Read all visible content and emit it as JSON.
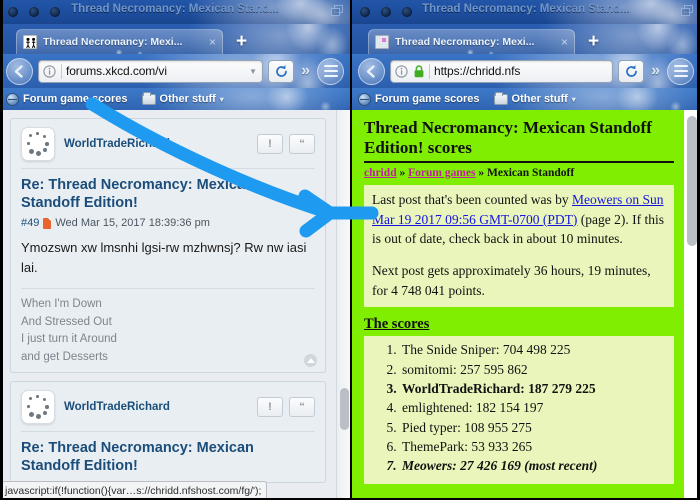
{
  "left_window": {
    "title": "Thread Necromancy: Mexican Stand...",
    "tab": {
      "label": "Thread Necromancy: Mexi...",
      "favicon": "xkcd-favicon",
      "close": "×"
    },
    "new_tab": "+",
    "nav": {
      "back_icon": "back-arrow-icon",
      "info_icon": "info-circle-icon",
      "url": "forums.xkcd.com/vi",
      "url_dim": "",
      "url_caret": "▼",
      "reload_icon": "reload-icon",
      "overflow": "»",
      "menu_icon": "hamburger-icon"
    },
    "bookmarks": [
      {
        "label": "Forum game scores",
        "icon": "globe-icon"
      },
      {
        "label": "Other stuff",
        "icon": "folder-icon",
        "caret": "▾"
      }
    ],
    "posts": [
      {
        "author": "WorldTradeRichard",
        "avatar": "dice-avatar",
        "buttons": [
          "!",
          "“"
        ],
        "subject": "Re: Thread Necromancy: Mexican Standoff Edition!",
        "post_number": "#49",
        "timestamp": "Wed Mar 15, 2017 18:39:36 pm",
        "body": "Ymozswn xw lmsnhi lgsi-rw mzhwnsj? Rw nw iasi lai.",
        "signature": [
          "When I'm Down",
          "And Stressed Out",
          "I just turn it Around",
          "and get Desserts"
        ]
      },
      {
        "author": "WorldTradeRichard",
        "avatar": "dice-avatar",
        "buttons": [
          "!",
          "“"
        ],
        "subject": "Re: Thread Necromancy: Mexican Standoff Edition!"
      }
    ],
    "status_bar": "javascript:if(!function(){var…s://chridd.nfshost.com/fg/');"
  },
  "right_window": {
    "title": "Thread Necromancy: Mexican Stand...",
    "tab": {
      "label": "Thread Necromancy: Mexi...",
      "favicon": "chridd-favicon",
      "close": "×"
    },
    "new_tab": "+",
    "nav": {
      "back_icon": "back-arrow-icon",
      "info_icon": "info-circle-icon",
      "lock_icon": "padlock-icon",
      "url": "https://chridd.nfs",
      "reload_icon": "reload-icon",
      "overflow": "»",
      "menu_icon": "hamburger-icon"
    },
    "bookmarks": [
      {
        "label": "Forum game scores",
        "icon": "globe-icon"
      },
      {
        "label": "Other stuff",
        "icon": "folder-icon",
        "caret": "▾"
      }
    ],
    "page": {
      "heading": "Thread Necromancy: Mexican Standoff Edition! scores",
      "breadcrumb": {
        "first": "chridd",
        "sep1": " » ",
        "second": "Forum games",
        "sep2": " » ",
        "third": "Mexican Standoff"
      },
      "status_p1_before": "Last post that's been counted was by ",
      "status_p1_link": "Meowers on Sun Mar 19 2017 09:56 GMT-0700 (PDT)",
      "status_p1_after": " (page 2). If this is out of date, check back in about 10 minutes.",
      "status_p2": "Next post gets approximately 36 hours, 19 minutes, for 4 748 041 points.",
      "scores_heading": "The scores",
      "scores": [
        {
          "text": "The Snide Sniper: 704 498 225",
          "style": "normal"
        },
        {
          "text": "somitomi: 257 595 862",
          "style": "normal"
        },
        {
          "text": "WorldTradeRichard: 187 279 225",
          "style": "bold"
        },
        {
          "text": "emlightened: 182 154 197",
          "style": "normal"
        },
        {
          "text": "Pied typer: 108 955 275",
          "style": "normal"
        },
        {
          "text": "ThemePark: 53 933 265",
          "style": "normal"
        },
        {
          "text": "Meowers: 27 426 169 (most recent)",
          "style": "italicbold"
        }
      ]
    }
  },
  "annotation": {
    "arrow_color": "#1e9bf0",
    "description": "blue-arrow-from-bookmark-to-scores-page"
  }
}
